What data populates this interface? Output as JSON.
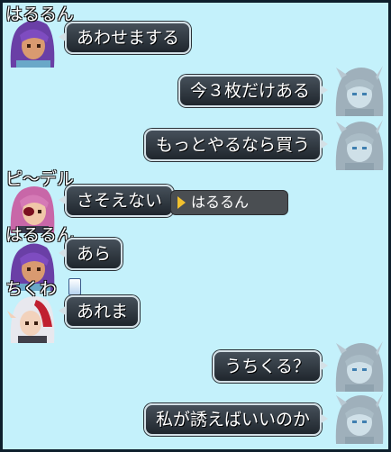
{
  "colors": {
    "panel_bg": "#c4f1fb",
    "bubble_bg": "#2f373f",
    "bubble_border": "#d4e0e6",
    "text": "#ffffff",
    "target_bg": "#4a4e52",
    "target_marker": "#f2c12e"
  },
  "messages": [
    {
      "side": "left",
      "speaker": "はるるん",
      "text": "あわせまする",
      "avatar": "purple-hair-avatar-icon"
    },
    {
      "side": "right",
      "text": "今３枚だけある",
      "avatar": "silver-hair-avatar-icon"
    },
    {
      "side": "right",
      "text": "もっとやるなら買う",
      "avatar": "silver-hair-avatar-icon"
    },
    {
      "side": "left",
      "speaker": "ピ～デル",
      "text": "さそえない",
      "avatar": "pink-hair-eyepatch-avatar-icon"
    },
    {
      "side": "left",
      "speaker": "はるるん",
      "text": "あら",
      "avatar": "purple-hair-avatar-icon"
    },
    {
      "side": "left",
      "speaker": "ちくわ",
      "text": "あれま",
      "avatar": "white-red-hair-avatar-icon",
      "badge": "card-icon"
    },
    {
      "side": "right",
      "text": "うちくる？",
      "avatar": "silver-hair-avatar-icon"
    },
    {
      "side": "right",
      "text": "私が誘えばいいのか",
      "avatar": "silver-hair-avatar-icon"
    }
  ],
  "target_label": {
    "text": "はるるん",
    "marker": "target-triangle-icon"
  }
}
